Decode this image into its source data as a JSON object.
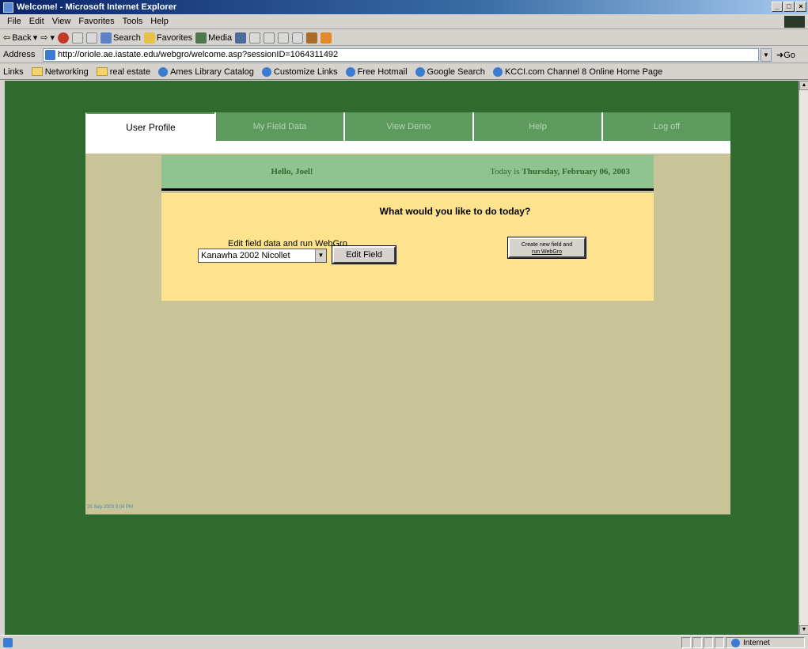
{
  "window": {
    "title": "Welcome! - Microsoft Internet Explorer",
    "buttons": [
      "_",
      "□",
      "×"
    ]
  },
  "menu": [
    "File",
    "Edit",
    "View",
    "Favorites",
    "Tools",
    "Help"
  ],
  "toolbar": {
    "back": "Back",
    "search": "Search",
    "favorites": "Favorites",
    "media": "Media"
  },
  "address": {
    "label": "Address",
    "url": "http://oriole.ae.iastate.edu/webgro/welcome.asp?sessionID=1064311492",
    "go": "Go"
  },
  "links": {
    "label": "Links",
    "items": [
      {
        "label": "Networking",
        "icon": "folder-icon"
      },
      {
        "label": "real estate",
        "icon": "folder-icon"
      },
      {
        "label": "Ames Library Catalog",
        "icon": "ie-icon"
      },
      {
        "label": "Customize Links",
        "icon": "ie-icon"
      },
      {
        "label": "Free Hotmail",
        "icon": "ie-icon"
      },
      {
        "label": "Google Search",
        "icon": "ie-icon"
      },
      {
        "label": "KCCI.com Channel 8 Online Home Page",
        "icon": "ie-icon"
      }
    ]
  },
  "tabs": [
    "User Profile",
    "My Field Data",
    "View Demo",
    "Help",
    "Log off"
  ],
  "greeting": {
    "hello": "Hello, Joel!",
    "date_prefix": "Today is",
    "date": "Thursday, February 06, 2003"
  },
  "actions": {
    "question": "What would you like to do today?",
    "edit_label": "Edit field data and run WebGro",
    "selected_field": "Kanawha 2002 Nicollet",
    "edit_button": "Edit Field",
    "create_button_line1": "Create new field and",
    "create_button_line2": "run WebGro"
  },
  "timestamp": "25 Sep 2003 9:04 PM",
  "status": {
    "zone": "Internet"
  },
  "colors": {
    "page_bg": "#2f6a2f",
    "panel_bg": "#c9c497",
    "tab_bg": "#5d9a5d",
    "hello_bg": "#8fc38f",
    "action_bg": "#fde38e"
  }
}
